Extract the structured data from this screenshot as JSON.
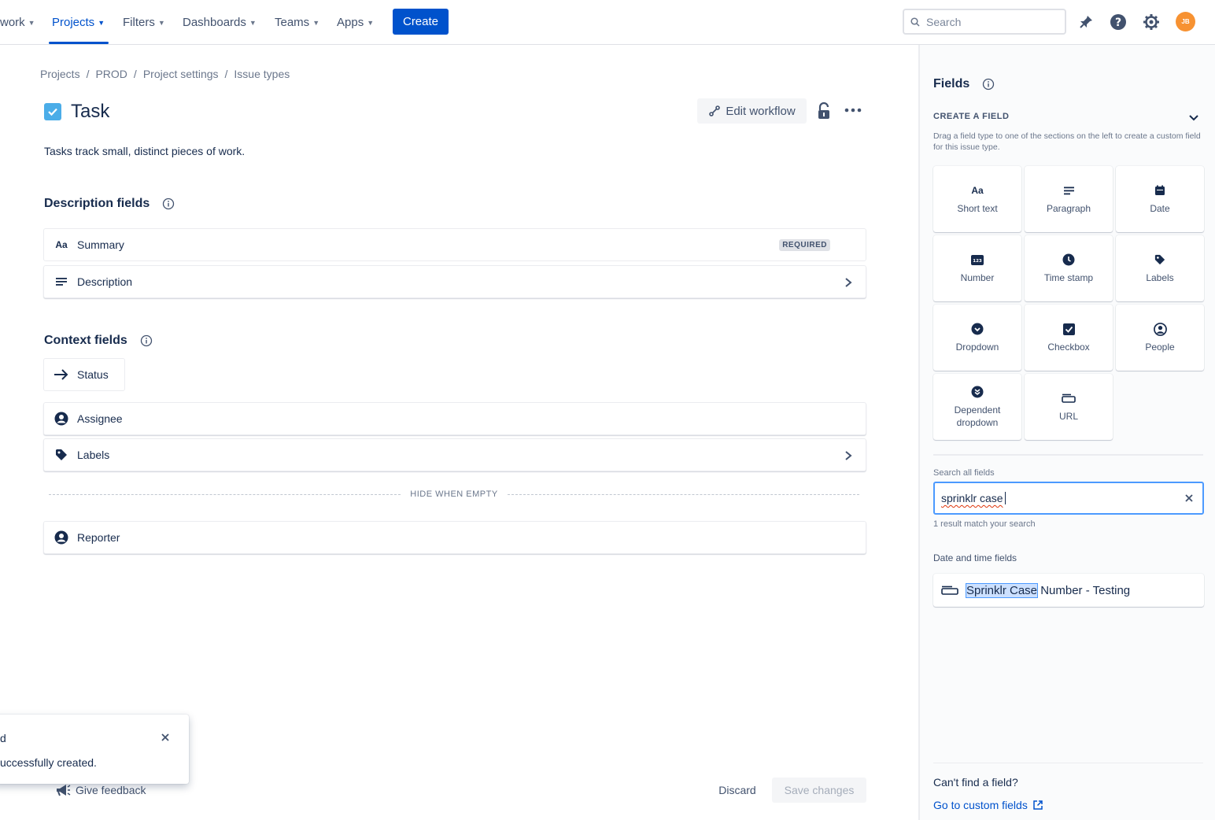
{
  "nav": {
    "items": [
      {
        "label": "work"
      },
      {
        "label": "Projects"
      },
      {
        "label": "Filters"
      },
      {
        "label": "Dashboards"
      },
      {
        "label": "Teams"
      },
      {
        "label": "Apps"
      }
    ],
    "create_label": "Create",
    "search_placeholder": "Search",
    "avatar_initials": "JB",
    "accent_color": "#0052cc"
  },
  "breadcrumb": [
    "Projects",
    "PROD",
    "Project settings",
    "Issue types"
  ],
  "issue_type": {
    "title": "Task",
    "description": "Tasks track small, distinct pieces of work.",
    "icon": "checkbox-icon",
    "edit_workflow_label": "Edit workflow"
  },
  "description_fields": {
    "title": "Description fields",
    "items": [
      {
        "label": "Summary",
        "icon_text": "Aa",
        "badge": "REQUIRED"
      },
      {
        "label": "Description",
        "icon": "paragraph-icon"
      }
    ]
  },
  "context_fields": {
    "title": "Context fields",
    "status": "Status",
    "items": [
      {
        "label": "Assignee",
        "icon": "person-icon"
      },
      {
        "label": "Labels",
        "icon": "tag-icon"
      }
    ],
    "hide_when_empty": "HIDE WHEN EMPTY",
    "hidden_items": [
      {
        "label": "Reporter",
        "icon": "person-icon"
      }
    ]
  },
  "toast": {
    "title": "d",
    "body": "uccessfully created."
  },
  "footer": {
    "feedback_label": "Give feedback",
    "discard_label": "Discard",
    "save_label": "Save changes"
  },
  "panel": {
    "title": "Fields",
    "create_heading": "CREATE A FIELD",
    "create_help": "Drag a field type to one of the sections on the left to create a custom field for this issue type.",
    "field_types": [
      {
        "label": "Short text",
        "icon": "short-text-icon",
        "icon_text": "Aa"
      },
      {
        "label": "Paragraph",
        "icon": "paragraph-icon"
      },
      {
        "label": "Date",
        "icon": "calendar-icon"
      },
      {
        "label": "Number",
        "icon": "number-icon",
        "icon_text": "123"
      },
      {
        "label": "Time stamp",
        "icon": "clock-icon"
      },
      {
        "label": "Labels",
        "icon": "tag-icon"
      },
      {
        "label": "Dropdown",
        "icon": "dropdown-icon"
      },
      {
        "label": "Checkbox",
        "icon": "checkbox-icon"
      },
      {
        "label": "People",
        "icon": "person-icon"
      },
      {
        "label": "Dependent dropdown",
        "icon": "dependent-dropdown-icon"
      },
      {
        "label": "URL",
        "icon": "url-icon"
      }
    ],
    "search_label": "Search all fields",
    "search_value": "sprinklr case",
    "result_count": "1 result match your search",
    "group_label": "Date and time fields",
    "result": {
      "match": "Sprinklr Case",
      "rest": " Number - Testing"
    },
    "cant_find": "Can't find a field?",
    "custom_link": "Go to custom fields"
  }
}
